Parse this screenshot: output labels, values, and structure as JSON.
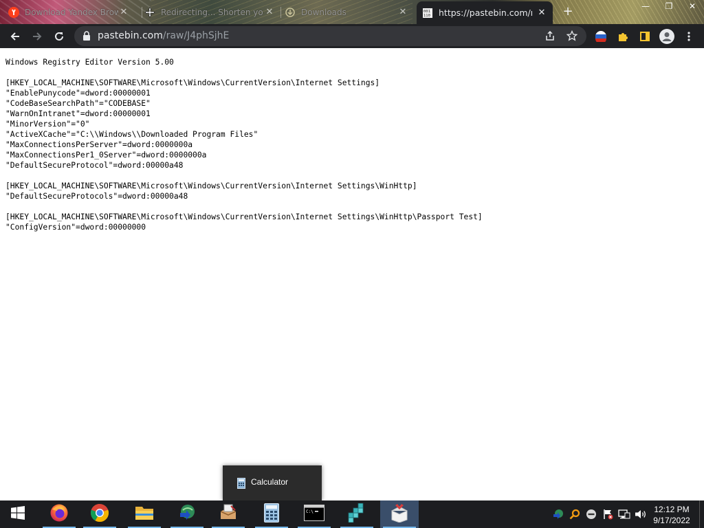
{
  "browser": {
    "tabs": [
      {
        "title": "Download Yandex Browser",
        "favicon": "yandex-icon",
        "active": false
      },
      {
        "title": "Redirecting... Shorten yo",
        "favicon": "move-cursor-icon",
        "active": false
      },
      {
        "title": "Downloads",
        "favicon": "downloads-icon",
        "active": false
      },
      {
        "title": "https://pastebin.com/raw/",
        "favicon": "pastebin-icon",
        "active": true
      }
    ],
    "new_tab_label": "+",
    "url": {
      "host": "pastebin.com",
      "path": "/raw/J4phSjhE"
    }
  },
  "page": {
    "lines": [
      "Windows Registry Editor Version 5.00",
      "",
      "[HKEY_LOCAL_MACHINE\\SOFTWARE\\Microsoft\\Windows\\CurrentVersion\\Internet Settings]",
      "\"EnablePunycode\"=dword:00000001",
      "\"CodeBaseSearchPath\"=\"CODEBASE\"",
      "\"WarnOnIntranet\"=dword:00000001",
      "\"MinorVersion\"=\"0\"",
      "\"ActiveXCache\"=\"C:\\\\Windows\\\\Downloaded Program Files\"",
      "\"MaxConnectionsPerServer\"=dword:0000000a",
      "\"MaxConnectionsPer1_0Server\"=dword:0000000a",
      "\"DefaultSecureProtocol\"=dword:00000a48",
      "",
      "[HKEY_LOCAL_MACHINE\\SOFTWARE\\Microsoft\\Windows\\CurrentVersion\\Internet Settings\\WinHttp]",
      "\"DefaultSecureProtocols\"=dword:00000a48",
      "",
      "[HKEY_LOCAL_MACHINE\\SOFTWARE\\Microsoft\\Windows\\CurrentVersion\\Internet Settings\\WinHttp\\Passport Test]",
      "\"ConfigVersion\"=dword:00000000"
    ]
  },
  "taskbar": {
    "thumbnail_title": "Calculator",
    "apps": [
      {
        "name": "start-button",
        "icon": "windows-logo-icon"
      },
      {
        "name": "firefox",
        "icon": "firefox-icon"
      },
      {
        "name": "chrome",
        "icon": "chrome-icon"
      },
      {
        "name": "file-explorer",
        "icon": "folder-icon"
      },
      {
        "name": "internet-download-manager",
        "icon": "idm-icon"
      },
      {
        "name": "installer",
        "icon": "installer-icon"
      },
      {
        "name": "calculator",
        "icon": "calculator-icon"
      },
      {
        "name": "command-prompt",
        "icon": "cmd-icon"
      },
      {
        "name": "registry-tool",
        "icon": "cubes-icon"
      },
      {
        "name": "unpack-app",
        "icon": "box-icon"
      }
    ],
    "clock_time": "12:12 PM",
    "clock_date": "9/17/2022"
  },
  "colors": {
    "toolbar": "#202124",
    "omnibox": "#35363a",
    "taskbar": "#1c1d20",
    "taskbar_active": "#3a4e6a",
    "taskbar_running_indicator": "#76b9ed"
  }
}
